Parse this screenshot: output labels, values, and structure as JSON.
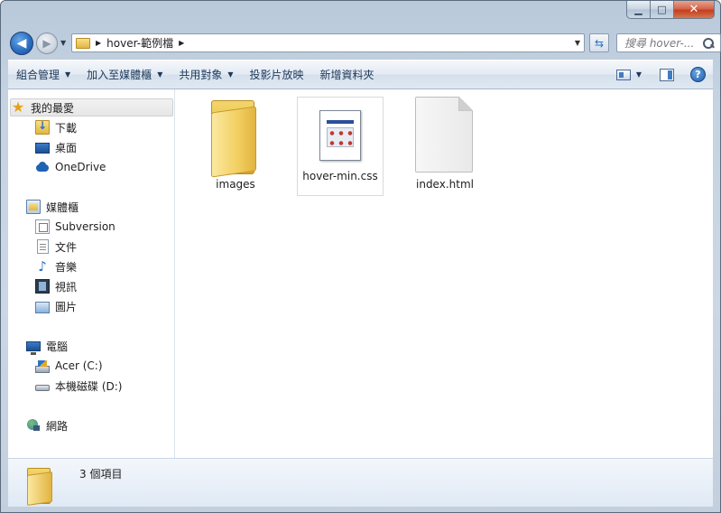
{
  "window": {
    "minimize_glyph": "▁",
    "maximize_glyph": "□",
    "close_glyph": "✕"
  },
  "nav": {
    "back_glyph": "◀",
    "forward_glyph": "▶",
    "address_path": "hover-範例檔",
    "search_placeholder": "搜尋 hover-..."
  },
  "commandbar": {
    "items": [
      {
        "label": "組合管理",
        "has_dropdown": true
      },
      {
        "label": "加入至媒體櫃",
        "has_dropdown": true
      },
      {
        "label": "共用對象",
        "has_dropdown": true
      },
      {
        "label": "投影片放映",
        "has_dropdown": false
      },
      {
        "label": "新增資料夾",
        "has_dropdown": false
      }
    ],
    "help_glyph": "?"
  },
  "navpane": {
    "favorites": "我的最愛",
    "downloads": "下載",
    "desktop": "桌面",
    "onedrive": "OneDrive",
    "libraries": "媒體櫃",
    "subversion": "Subversion",
    "documents": "文件",
    "music": "音樂",
    "videos": "視訊",
    "pictures": "圖片",
    "computer": "電腦",
    "drive_c": "Acer (C:)",
    "drive_d": "本機磁碟 (D:)",
    "network": "網路"
  },
  "files": [
    {
      "name": "images",
      "type": "folder"
    },
    {
      "name": "hover-min.css",
      "type": "css"
    },
    {
      "name": "index.html",
      "type": "html"
    }
  ],
  "details": {
    "item_count": "3 個項目"
  },
  "icons": {
    "favorites": "star-icon",
    "music": "music-note-icon"
  }
}
